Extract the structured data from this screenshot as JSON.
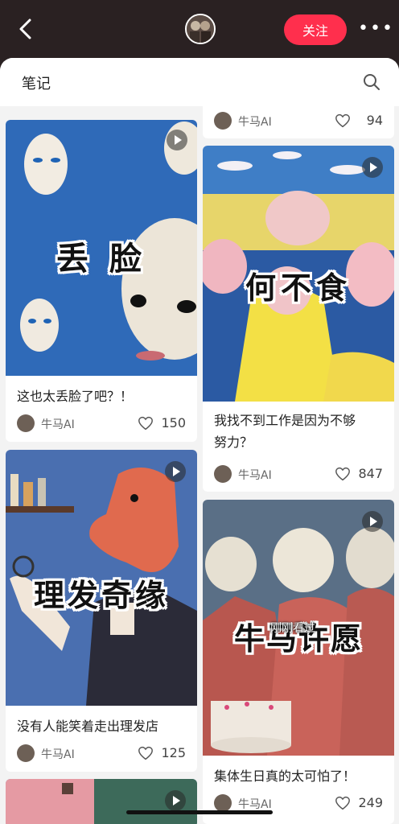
{
  "header": {
    "follow_label": "关注",
    "more_label": "•••"
  },
  "sheet": {
    "title": "笔记"
  },
  "cards": [
    {
      "cover_text": "",
      "title": "",
      "author": "牛马AI",
      "likes": "94"
    },
    {
      "cover_text": "丢 脸",
      "title": "这也太丢脸了吧？！",
      "author": "牛马AI",
      "likes": "150"
    },
    {
      "cover_text": "何不食",
      "title_line1": "我找不到工作是因为不够",
      "title_line2": "努力？",
      "author": "牛马AI",
      "likes": "847"
    },
    {
      "cover_text": "理发奇缘",
      "title": "没有人能笑着走出理发店",
      "author": "牛马AI",
      "likes": "125"
    },
    {
      "cover_text": "牛马许愿",
      "title": "集体生日真的太可怕了！",
      "author": "牛马AI",
      "likes": "249"
    }
  ],
  "badge": {
    "recently_viewed": "刚刚看过"
  },
  "colors": {
    "accent": "#ff2f4d",
    "topbar": "#2a2122",
    "background": "#f3f3f3"
  },
  "icons": [
    "back-icon",
    "avatar",
    "more-icon",
    "search-icon",
    "play-icon",
    "heart-icon"
  ]
}
